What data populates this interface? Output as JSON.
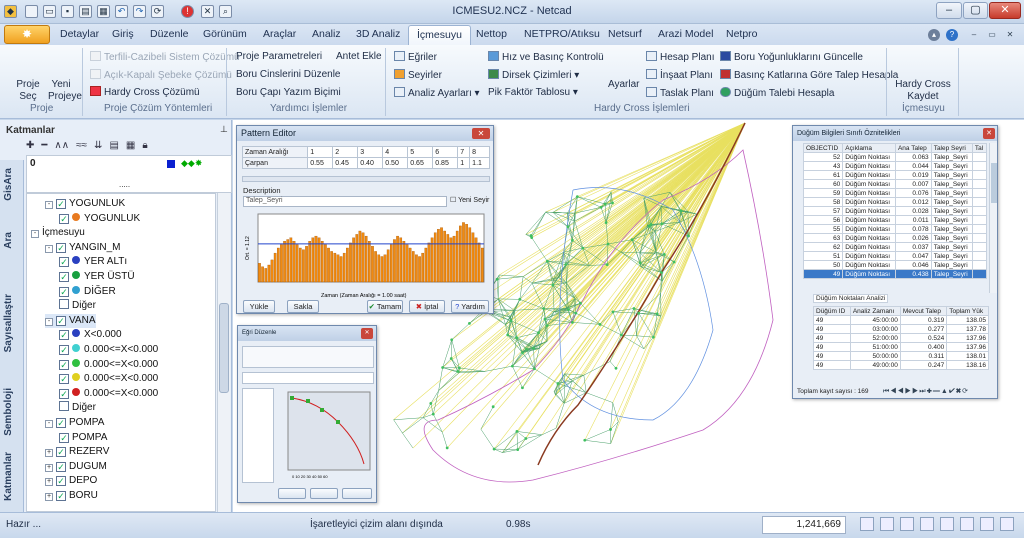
{
  "window": {
    "title": "ICMESU2.NCZ - Netcad"
  },
  "tabs": [
    {
      "label": "Detaylar"
    },
    {
      "label": "Giriş"
    },
    {
      "label": "Düzenle"
    },
    {
      "label": "Görünüm"
    },
    {
      "label": "Araçlar"
    },
    {
      "label": "Analiz"
    },
    {
      "label": "3D Analiz"
    },
    {
      "label": "İçmesuyu"
    },
    {
      "label": "Nettop"
    },
    {
      "label": "NETPRO/Atıksu"
    },
    {
      "label": "Netsurf"
    },
    {
      "label": "Arazi Model"
    },
    {
      "label": "Netpro"
    }
  ],
  "ribbon": {
    "proje": {
      "seç": "Proje Seç",
      "yeni": "Yeni Projeye",
      "group": "Proje"
    },
    "cozum": {
      "terfili": "Terfili-Cazibeli Sistem Çözümü",
      "acik": "Açık-Kapalı Şebeke Çözümü",
      "hardy": "Hardy Cross Çözümü",
      "group": "Proje Çözüm Yöntemleri"
    },
    "yardimci": {
      "param": "Proje Parametreleri",
      "antet": "Antet Ekle",
      "cins": "Boru Cinslerini Düzenle",
      "cap": "Boru Çapı Yazım Biçimi",
      "group": "Yardımcı İşlemler"
    },
    "hardy": {
      "egriler": "Eğriler",
      "seyirler": "Seyirler",
      "analiz": "Analiz Ayarları",
      "hiz": "Hız ve Basınç Kontrolü",
      "dirsek": "Dirsek Çizimleri",
      "pik": "Pik Faktör Tablosu",
      "ayarlar": "Ayarlar",
      "hesap": "Hesap Planı",
      "insaat": "İnşaat Planı",
      "taslak": "Taslak Planı",
      "yogunluk": "Boru Yoğunluklarını Güncelle",
      "basinc": "Basınç Katlarına Göre Talep Hesapla",
      "dugum": "Düğüm Talebi Hesapla",
      "group": "Hardy Cross İşlemleri"
    },
    "kaydet": {
      "label": "Hardy Cross Kaydet",
      "group": "İçmesuyu"
    }
  },
  "left": {
    "title": "Katmanlar",
    "legend_value": "0",
    "vtabs": [
      "GisAra",
      "Ara",
      "Sayısallaştır",
      "Semboloji",
      "Katmanlar"
    ],
    "tree": [
      {
        "label": "YOGUNLUK",
        "lvl": 1,
        "pm": "-",
        "cb": true,
        "row": 0
      },
      {
        "label": "YOGUNLUK",
        "lvl": 2,
        "cb": true,
        "row": 1,
        "dot": "#e87a20"
      },
      {
        "label": "İçmesuyu",
        "lvl": 0,
        "pm": "-",
        "row": 2
      },
      {
        "label": "YANGIN_M",
        "lvl": 1,
        "pm": "-",
        "cb": true,
        "row": 3
      },
      {
        "label": "YER ALTı",
        "lvl": 2,
        "cb": true,
        "row": 4,
        "dot": "#2a40c0"
      },
      {
        "label": "YER ÜSTÜ",
        "lvl": 2,
        "cb": true,
        "row": 5,
        "dot": "#18a040"
      },
      {
        "label": "DİĞER",
        "lvl": 2,
        "cb": true,
        "row": 6,
        "dot": "#30a0d0"
      },
      {
        "label": "Diğer",
        "lvl": 2,
        "cb": false,
        "row": 7
      },
      {
        "label": "VANA",
        "lvl": 1,
        "pm": "-",
        "cb": true,
        "row": 8,
        "sel": true
      },
      {
        "label": "X<0.000",
        "lvl": 2,
        "cb": true,
        "row": 9,
        "dot": "#2a40c0"
      },
      {
        "label": "0.000<=X<0.000",
        "lvl": 2,
        "cb": true,
        "row": 10,
        "dot": "#40d0d0"
      },
      {
        "label": "0.000<=X<0.000",
        "lvl": 2,
        "cb": true,
        "row": 11,
        "dot": "#30c040"
      },
      {
        "label": "0.000<=X<0.000",
        "lvl": 2,
        "cb": true,
        "row": 12,
        "dot": "#e0d020"
      },
      {
        "label": "0.000<=X<0.000",
        "lvl": 2,
        "cb": true,
        "row": 13,
        "dot": "#d02020"
      },
      {
        "label": "Diğer",
        "lvl": 2,
        "cb": false,
        "row": 14
      },
      {
        "label": "POMPA",
        "lvl": 1,
        "pm": "-",
        "cb": true,
        "row": 15
      },
      {
        "label": "POMPA",
        "lvl": 2,
        "cb": true,
        "row": 16
      },
      {
        "label": "REZERV",
        "lvl": 1,
        "pm": "+",
        "cb": true,
        "row": 17
      },
      {
        "label": "DUGUM",
        "lvl": 1,
        "pm": "+",
        "cb": true,
        "row": 18
      },
      {
        "label": "DEPO",
        "lvl": 1,
        "pm": "+",
        "cb": true,
        "row": 19
      },
      {
        "label": "BORU",
        "lvl": 1,
        "pm": "+",
        "cb": true,
        "row": 20
      }
    ]
  },
  "pattern": {
    "title": "Pattern Editor",
    "row1": [
      "Zaman Aralığı",
      "1",
      "2",
      "3",
      "4",
      "5",
      "6",
      "7",
      "8"
    ],
    "row2": [
      "Çarpan",
      "0.55",
      "0.45",
      "0.40",
      "0.50",
      "0.65",
      "0.85",
      "1",
      "1.1"
    ],
    "desc_label": "Description",
    "desc_value": "Talep_Seyri",
    "new_seyir": "Yeni Seyir",
    "ylabel": "Ort. = 1.12",
    "xlabel": "Zaman (Zaman Aralığı = 1.00 saat)",
    "buttons": [
      "Yükle",
      "Sakla",
      "Tamam",
      "İptal",
      "Yardım"
    ],
    "bars": [
      0.55,
      0.45,
      0.4,
      0.5,
      0.65,
      0.85,
      1,
      1.1,
      1.2,
      1.25,
      1.3,
      1.2,
      1.1,
      1.0,
      0.95,
      1.05,
      1.2,
      1.3,
      1.35,
      1.3,
      1.2,
      1.1,
      1.0,
      0.9,
      0.85,
      0.8,
      0.75,
      0.85,
      1.0,
      1.15,
      1.3,
      1.4,
      1.5,
      1.45,
      1.35,
      1.2,
      1.05,
      0.9,
      0.8,
      0.75,
      0.8,
      0.95,
      1.1,
      1.25,
      1.35,
      1.3,
      1.2,
      1.1,
      1.0,
      0.9,
      0.8,
      0.75,
      0.85,
      1.0,
      1.15,
      1.3,
      1.45,
      1.55,
      1.6,
      1.5,
      1.4,
      1.3,
      1.35,
      1.5,
      1.65,
      1.75,
      1.7,
      1.6,
      1.45,
      1.3,
      1.15,
      1.0
    ]
  },
  "pump": {
    "title": "Eğri Düzenle",
    "ticks": "0 10 20 30 40 50 60"
  },
  "attrs": {
    "title": "Düğüm Bilgileri Sınıfı Öznitelikleri",
    "headers": [
      "OBJECTID",
      "Açıklama",
      "Ana Talep",
      "Talep Seyri",
      "Tal"
    ],
    "rows": [
      [
        "52",
        "Düğüm Noktası",
        "0.063",
        "Talep_Seyri"
      ],
      [
        "43",
        "Düğüm Noktası",
        "0.044",
        "Talep_Seyri"
      ],
      [
        "61",
        "Düğüm Noktası",
        "0.019",
        "Talep_Seyri"
      ],
      [
        "60",
        "Düğüm Noktası",
        "0.007",
        "Talep_Seyri"
      ],
      [
        "59",
        "Düğüm Noktası",
        "0.076",
        "Talep_Seyri"
      ],
      [
        "58",
        "Düğüm Noktası",
        "0.012",
        "Talep_Seyri"
      ],
      [
        "57",
        "Düğüm Noktası",
        "0.028",
        "Talep_Seyri"
      ],
      [
        "56",
        "Düğüm Noktası",
        "0.011",
        "Talep_Seyri"
      ],
      [
        "55",
        "Düğüm Noktası",
        "0.078",
        "Talep_Seyri"
      ],
      [
        "63",
        "Düğüm Noktası",
        "0.026",
        "Talep_Seyri"
      ],
      [
        "62",
        "Düğüm Noktası",
        "0.037",
        "Talep_Seyri"
      ],
      [
        "51",
        "Düğüm Noktası",
        "0.047",
        "Talep_Seyri"
      ],
      [
        "50",
        "Düğüm Noktası",
        "0.046",
        "Talep_Seyri"
      ],
      [
        "49",
        "Düğüm Noktası",
        "0.438",
        "Talep_Seyri"
      ]
    ],
    "sub_title": "Düğüm Noktaları Analizi",
    "sub_headers": [
      "Düğüm ID",
      "Analiz Zamanı",
      "Mevcut Talep",
      "Toplam Yük"
    ],
    "sub_rows": [
      [
        "49",
        "45:00:00",
        "0.319",
        "138.05"
      ],
      [
        "49",
        "03:00:00",
        "0.277",
        "137.78"
      ],
      [
        "49",
        "52:00:00",
        "0.524",
        "137.96"
      ],
      [
        "49",
        "51:00:00",
        "0.400",
        "137.96"
      ],
      [
        "49",
        "50:00:00",
        "0.311",
        "138.01"
      ],
      [
        "49",
        "49:00:00",
        "0.247",
        "138.16"
      ]
    ],
    "footer": "Toplam kayıt sayısı : 169"
  },
  "status": {
    "left": "Hazır ...",
    "msg": "İşaretleyici çizim alanı dışında",
    "time": "0.98s",
    "coord": "1,241,669"
  }
}
